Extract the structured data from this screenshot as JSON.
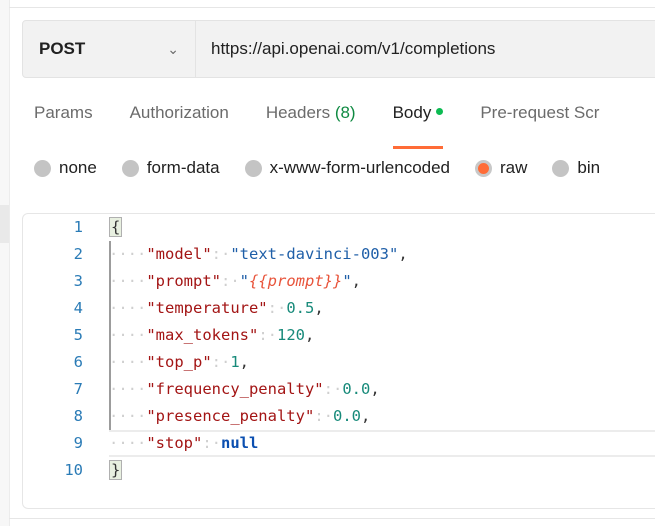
{
  "request": {
    "method": "POST",
    "url": "https://api.openai.com/v1/completions"
  },
  "tabs": [
    {
      "label": "Params"
    },
    {
      "label": "Authorization"
    },
    {
      "label": "Headers",
      "count": "(8)"
    },
    {
      "label": "Body",
      "active": true,
      "indicator": "green-dot"
    },
    {
      "label": "Pre-request Scr"
    }
  ],
  "body_types": [
    {
      "label": "none"
    },
    {
      "label": "form-data"
    },
    {
      "label": "x-www-form-urlencoded"
    },
    {
      "label": "raw",
      "selected": true
    },
    {
      "label": "bin"
    }
  ],
  "colors": {
    "accent": "#ff6c37",
    "indicator": "#0cbb52"
  },
  "editor": {
    "line_numbers": [
      "1",
      "2",
      "3",
      "4",
      "5",
      "6",
      "7",
      "8",
      "9",
      "10"
    ],
    "lines": [
      {
        "open_brace": "{"
      },
      {
        "key": "\"model\"",
        "value": "\"text-davinci-003\"",
        "trail": ","
      },
      {
        "key": "\"prompt\"",
        "q1": "\"",
        "var": "{{prompt}}",
        "q2": "\"",
        "trail": ","
      },
      {
        "key": "\"temperature\"",
        "value": "0.5",
        "trail": ","
      },
      {
        "key": "\"max_tokens\"",
        "value": "120",
        "trail": ","
      },
      {
        "key": "\"top_p\"",
        "value": "1",
        "trail": ","
      },
      {
        "key": "\"frequency_penalty\"",
        "value": "0.0",
        "trail": ","
      },
      {
        "key": "\"presence_penalty\"",
        "value": "0.0",
        "trail": ","
      },
      {
        "key": "\"stop\"",
        "value": "null"
      },
      {
        "close_brace": "}"
      }
    ],
    "indent": "····",
    "colon": ":·"
  }
}
